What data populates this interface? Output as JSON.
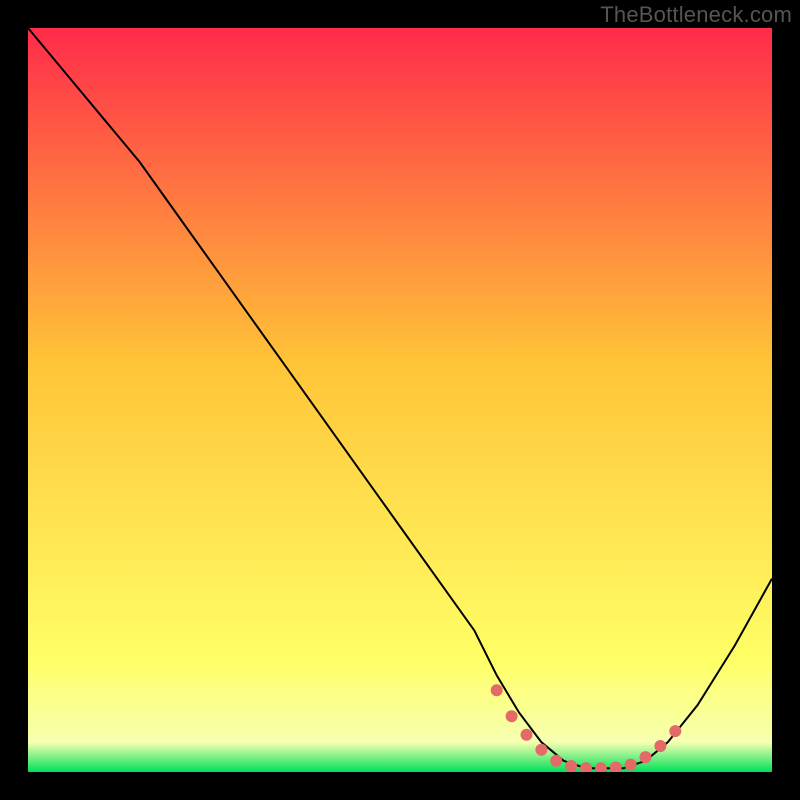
{
  "watermark": "TheBottleneck.com",
  "colors": {
    "background_black": "#000000",
    "gradient_top": "#ff2b4a",
    "gradient_mid": "#ffc438",
    "gradient_low": "#ffff66",
    "gradient_bottom": "#00e05a",
    "curve": "#000000",
    "marker": "#e36a66"
  },
  "chart_data": {
    "type": "line",
    "title": "",
    "xlabel": "",
    "ylabel": "",
    "xlim": [
      0,
      100
    ],
    "ylim": [
      0,
      100
    ],
    "grid": false,
    "legend": false,
    "series": [
      {
        "name": "bottleneck-curve",
        "x": [
          0,
          5,
          10,
          15,
          20,
          25,
          30,
          35,
          40,
          45,
          50,
          55,
          60,
          63,
          66,
          69,
          72,
          75,
          78,
          80,
          83,
          86,
          90,
          95,
          100
        ],
        "values": [
          100,
          94,
          88,
          82,
          75,
          68,
          61,
          54,
          47,
          40,
          33,
          26,
          19,
          13,
          8,
          4,
          1.5,
          0.5,
          0.5,
          0.5,
          1.5,
          4,
          9,
          17,
          26
        ]
      }
    ],
    "markers": {
      "name": "highlight-dots",
      "x": [
        63,
        65,
        67,
        69,
        71,
        73,
        75,
        77,
        79,
        81,
        83,
        85,
        87
      ],
      "values": [
        11,
        7.5,
        5,
        3,
        1.5,
        0.8,
        0.5,
        0.5,
        0.6,
        1,
        2,
        3.5,
        5.5
      ]
    }
  }
}
